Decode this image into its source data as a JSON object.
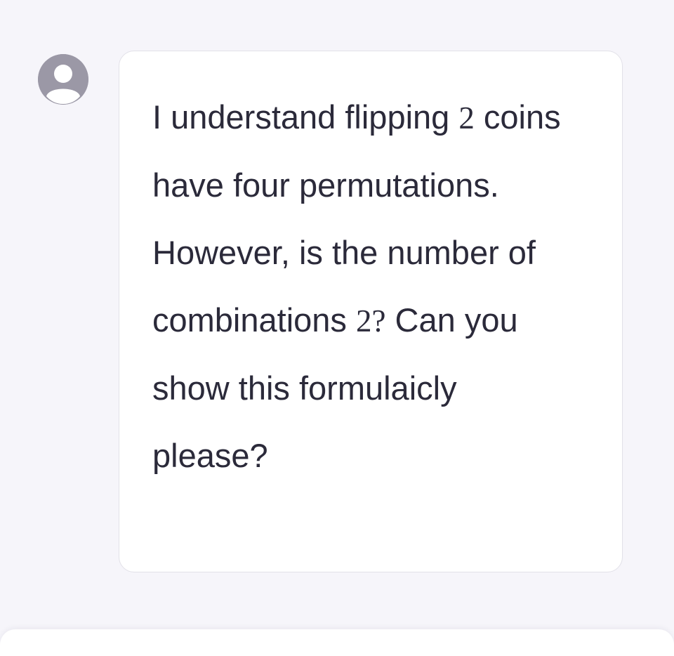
{
  "message": {
    "role": "user",
    "segments": [
      {
        "text": "I understand flipping ",
        "math": false
      },
      {
        "text": "2",
        "math": true
      },
      {
        "text": " coins have four permutations. However, is the number of combinations ",
        "math": false
      },
      {
        "text": "2",
        "math": true
      },
      {
        "text": "?",
        "math": true
      },
      {
        "text": " Can you show this formulaicly please?",
        "math": false
      }
    ]
  },
  "colors": {
    "background": "#f6f5fa",
    "bubble": "#ffffff",
    "bubble_border": "#e2e1e8",
    "text": "#2b2a3a",
    "avatar": "#9b98a6"
  },
  "icons": {
    "avatar": "user-avatar-icon"
  }
}
